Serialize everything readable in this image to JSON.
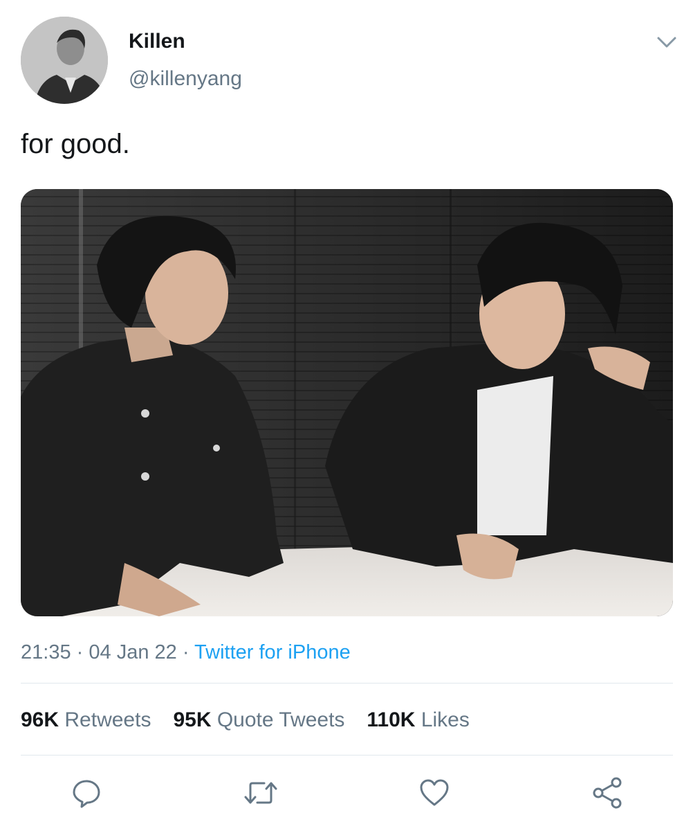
{
  "tweet": {
    "author": {
      "display_name": "Killen",
      "handle": "@killenyang"
    },
    "text": "for good.",
    "meta": {
      "time": "21:35",
      "separator": "·",
      "date": "04 Jan 22",
      "source": "Twitter for iPhone"
    },
    "stats": {
      "retweets": {
        "value": "96K",
        "label": "Retweets"
      },
      "quotes": {
        "value": "95K",
        "label": "Quote Tweets"
      },
      "likes": {
        "value": "110K",
        "label": "Likes"
      }
    }
  },
  "icons": {
    "more": "chevron-down-icon",
    "reply": "reply-icon",
    "retweet": "retweet-icon",
    "like": "heart-icon",
    "share": "share-icon"
  },
  "colors": {
    "accent": "#1da1f2",
    "text_primary": "#14171a",
    "text_secondary": "#657786",
    "divider": "#e1e8ed"
  }
}
